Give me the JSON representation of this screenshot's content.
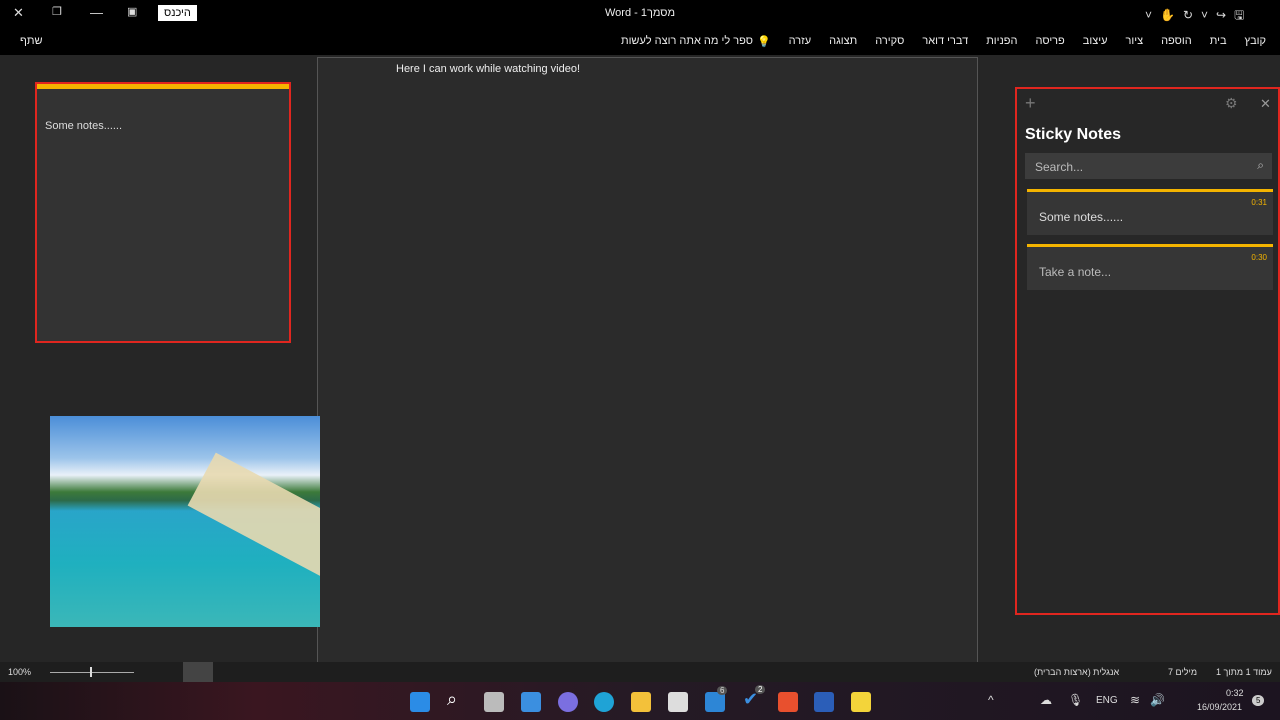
{
  "titlebar": {
    "title": "Word  -  מסמך1",
    "signin": "היכנס"
  },
  "ribbon": {
    "tabs": [
      "קובץ",
      "בית",
      "הוספה",
      "ציור",
      "עיצוב",
      "פריסה",
      "הפניות",
      "דברי דואר",
      "סקירה",
      "תצוגה",
      "עזרה"
    ],
    "tell_me": "ספר לי מה אתה רוצה לעשות",
    "share": "שתף"
  },
  "document": {
    "text": "Here I can work while watching video!"
  },
  "note": {
    "text": "Some notes......"
  },
  "sticky": {
    "title": "Sticky Notes",
    "search_placeholder": "Search...",
    "notes": [
      {
        "text": "Some notes......",
        "time": "0:31"
      },
      {
        "text": "Take a note...",
        "time": "0:30"
      }
    ],
    "accent": "#f4b400"
  },
  "status": {
    "zoom": "100%",
    "page": "עמוד 1 מתוך 1",
    "words": "7 מילים",
    "language": "אנגלית (ארצות הברית)"
  },
  "taskbar": {
    "lang": "ENG",
    "time": "0:32",
    "date": "16/09/2021",
    "mail_badge": "6",
    "todo_badge": "2",
    "notif": "5"
  }
}
